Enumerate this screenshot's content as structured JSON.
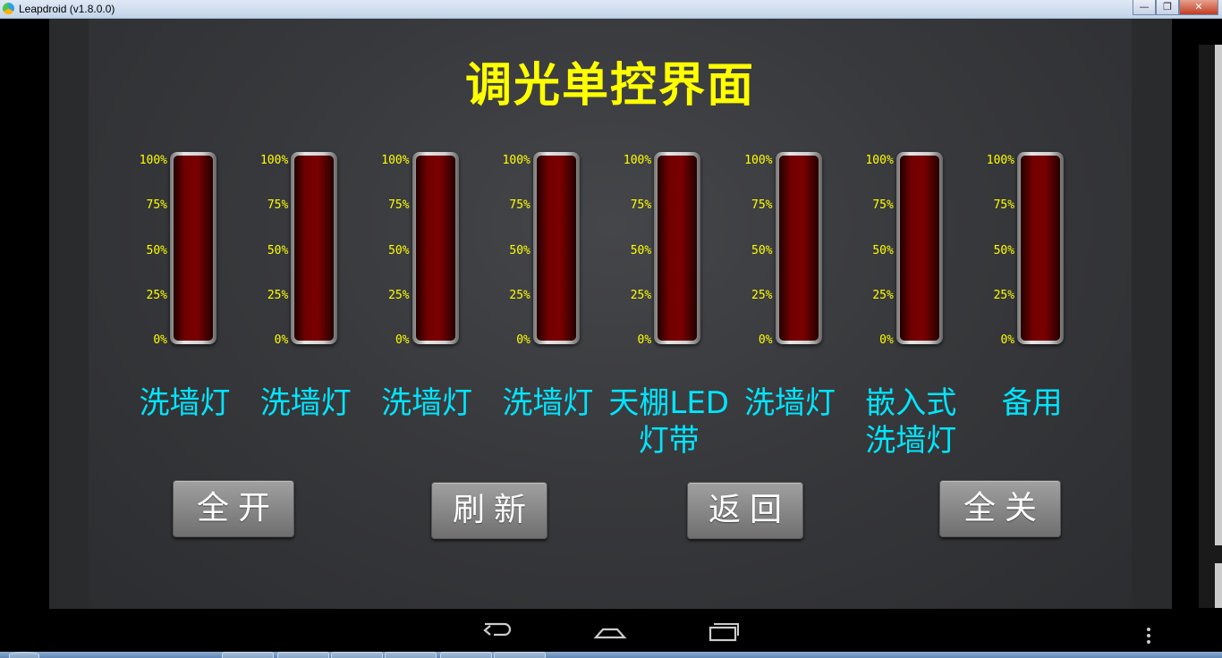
{
  "window": {
    "title": "Leapdroid (v1.8.0.0)",
    "minimize_icon": "minimize-icon",
    "maximize_icon": "restore-icon",
    "close_icon": "close-icon"
  },
  "app": {
    "title": "调光单控界面",
    "scale_labels": [
      "100%",
      "75%",
      "50%",
      "25%",
      "0%"
    ],
    "channels": [
      {
        "name": "洗墙灯",
        "level_percent": 0
      },
      {
        "name": "洗墙灯",
        "level_percent": 0
      },
      {
        "name": "洗墙灯",
        "level_percent": 0
      },
      {
        "name": "洗墙灯",
        "level_percent": 0
      },
      {
        "name": "天棚LED\n灯带",
        "level_percent": 0
      },
      {
        "name": "洗墙灯",
        "level_percent": 0
      },
      {
        "name": "嵌入式\n洗墙灯",
        "level_percent": 0
      },
      {
        "name": "备用",
        "level_percent": 0
      }
    ],
    "buttons": {
      "all_on": "全开",
      "refresh": "刷新",
      "back": "返回",
      "all_off": "全关"
    },
    "colors": {
      "title": "#ffff00",
      "scale": "#ffff00",
      "channel_name": "#00e5ff",
      "bar_empty": "#720000"
    }
  },
  "navbar": {
    "back_icon": "back-arrow-icon",
    "home_icon": "home-icon",
    "recents_icon": "recents-icon",
    "menu_icon": "overflow-menu-icon"
  }
}
